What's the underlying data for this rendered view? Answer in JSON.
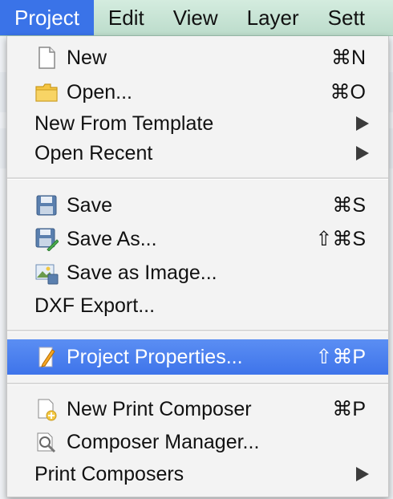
{
  "menubar": {
    "items": [
      {
        "label": "Project"
      },
      {
        "label": "Edit"
      },
      {
        "label": "View"
      },
      {
        "label": "Layer"
      },
      {
        "label": "Sett"
      }
    ]
  },
  "menu": {
    "items": [
      {
        "label": "New",
        "shortcut": "⌘N",
        "icon": "new-file-icon"
      },
      {
        "label": "Open...",
        "shortcut": "⌘O",
        "icon": "folder-icon"
      },
      {
        "label": "New From Template",
        "submenu": true
      },
      {
        "label": "Open Recent",
        "submenu": true
      },
      {
        "label": "Save",
        "shortcut": "⌘S",
        "icon": "save-icon"
      },
      {
        "label": "Save As...",
        "shortcut": "⇧⌘S",
        "icon": "save-as-icon"
      },
      {
        "label": "Save as Image...",
        "icon": "save-image-icon"
      },
      {
        "label": "DXF Export..."
      },
      {
        "label": "Project Properties...",
        "shortcut": "⇧⌘P",
        "icon": "pencil-icon",
        "highlighted": true
      },
      {
        "label": "New Print Composer",
        "shortcut": "⌘P",
        "icon": "new-composer-icon"
      },
      {
        "label": "Composer Manager...",
        "icon": "composer-manager-icon"
      },
      {
        "label": "Print Composers",
        "submenu": true
      }
    ]
  },
  "colors": {
    "menubar_bg": "#c6e3d3",
    "active_menu": "#3a73e8",
    "highlight": "#4a7fee"
  }
}
